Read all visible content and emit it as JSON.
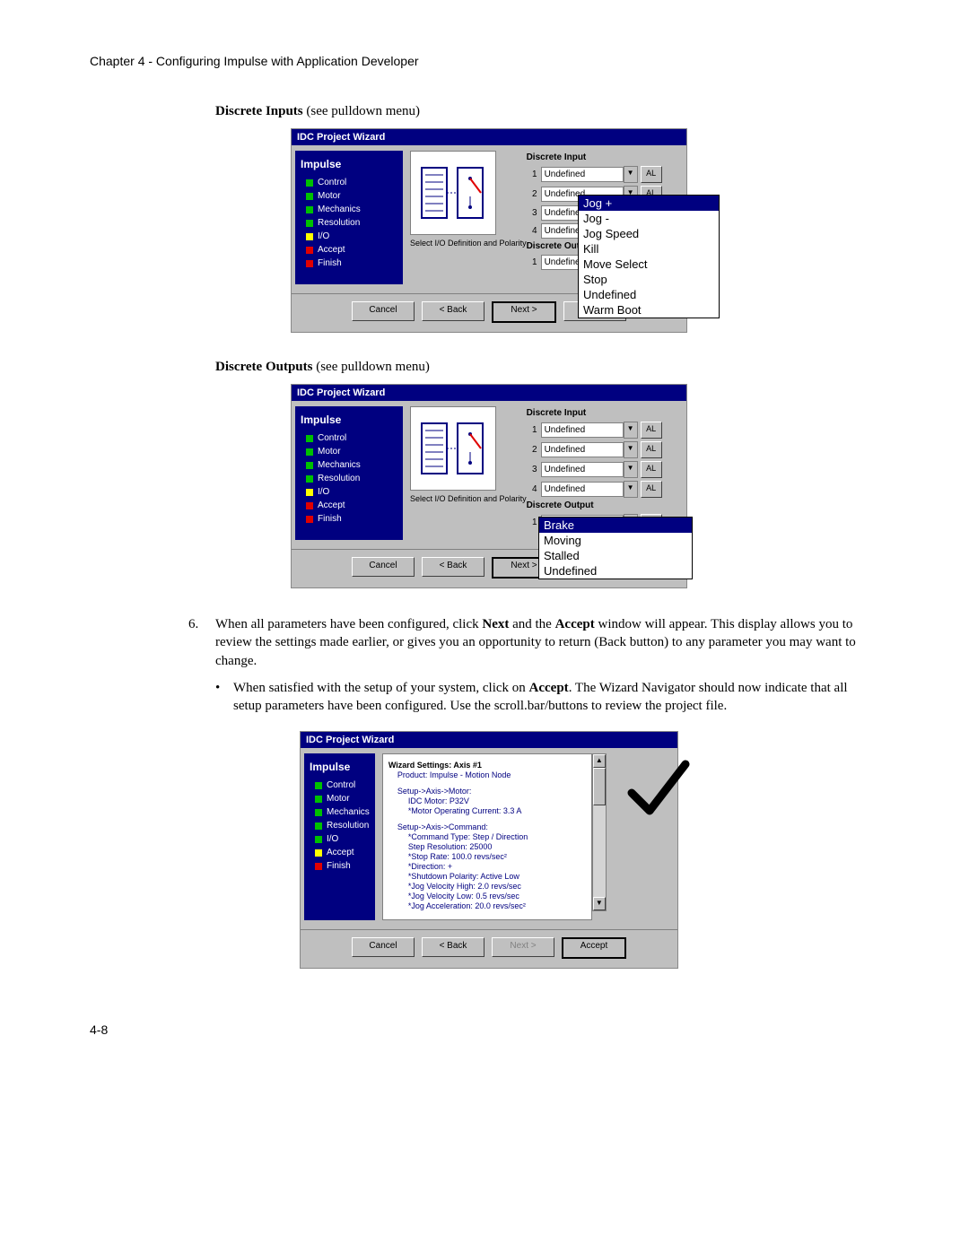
{
  "chapter_header": "Chapter 4 - Configuring Impulse with Application Developer",
  "page_number": "4-8",
  "sections": {
    "discrete_inputs": {
      "bold": "Discrete Inputs",
      "rest": " (see pulldown menu)"
    },
    "discrete_outputs": {
      "bold": "Discrete Outputs",
      "rest": " (see pulldown menu)"
    }
  },
  "step6": {
    "num": "6.",
    "text_parts": [
      "When all parameters have been configured, click ",
      "Next",
      " and the ",
      "Accept",
      " window will appear. This display allows you to review the settings made earlier, or gives you an opportunity to return (Back button) to any parameter you may want to change."
    ],
    "bullet": {
      "parts": [
        "When satisfied with the setup of your system, click on ",
        "Accept",
        ". The Wizard Navigator should now indicate that all setup parameters have been configured. Use the scroll.bar/buttons to review the project file."
      ]
    }
  },
  "wizard": {
    "title": "IDC Project Wizard",
    "nav_title": "Impulse",
    "nav_items_io": [
      {
        "label": "Control",
        "color": "green"
      },
      {
        "label": "Motor",
        "color": "green"
      },
      {
        "label": "Mechanics",
        "color": "green"
      },
      {
        "label": "Resolution",
        "color": "green"
      },
      {
        "label": "I/O",
        "color": "yellow"
      },
      {
        "label": "Accept",
        "color": "red"
      },
      {
        "label": "Finish",
        "color": "red"
      }
    ],
    "nav_items_accept": [
      {
        "label": "Control",
        "color": "green"
      },
      {
        "label": "Motor",
        "color": "green"
      },
      {
        "label": "Mechanics",
        "color": "green"
      },
      {
        "label": "Resolution",
        "color": "green"
      },
      {
        "label": "I/O",
        "color": "green"
      },
      {
        "label": "Accept",
        "color": "yellow"
      },
      {
        "label": "Finish",
        "color": "red"
      }
    ],
    "illus_caption": "Select I/O Definition and Polarity",
    "di_label": "Discrete Input",
    "do_label": "Discrete Output",
    "undefined": "Undefined",
    "al": "AL",
    "buttons": {
      "cancel": "Cancel",
      "back": "< Back",
      "next": "Next >",
      "accept": "Accept"
    }
  },
  "dropdown1": {
    "options": [
      "Jog +",
      "Jog -",
      "Jog Speed",
      "Kill",
      "Move Select",
      "Stop",
      "Undefined",
      "Warm Boot"
    ],
    "selected": "Jog +"
  },
  "dropdown2": {
    "options": [
      "Brake",
      "Moving",
      "Stalled",
      "Undefined"
    ],
    "selected": "Brake"
  },
  "summary": {
    "header": "Wizard Settings:  Axis #1",
    "lines": [
      {
        "t": "Product:  Impulse - Motion Node",
        "i": 1
      },
      {
        "t": "Setup->Axis->Motor:",
        "i": 1
      },
      {
        "t": "IDC Motor:  P32V",
        "i": 2
      },
      {
        "t": "*Motor Operating Current:  3.3 A",
        "i": 2
      },
      {
        "t": "Setup->Axis->Command:",
        "i": 1
      },
      {
        "t": "*Command Type:  Step / Direction",
        "i": 2
      },
      {
        "t": "Step Resolution:  25000",
        "i": 2
      },
      {
        "t": "*Stop Rate:  100.0 revs/sec²",
        "i": 2
      },
      {
        "t": "*Direction:  +",
        "i": 2
      },
      {
        "t": "*Shutdown Polarity:  Active Low",
        "i": 2
      },
      {
        "t": "*Jog Velocity High:  2.0 revs/sec",
        "i": 2
      },
      {
        "t": "*Jog Velocity Low:  0.5 revs/sec",
        "i": 2
      },
      {
        "t": "*Jog Acceleration:  20.0 revs/sec²",
        "i": 2
      }
    ]
  }
}
